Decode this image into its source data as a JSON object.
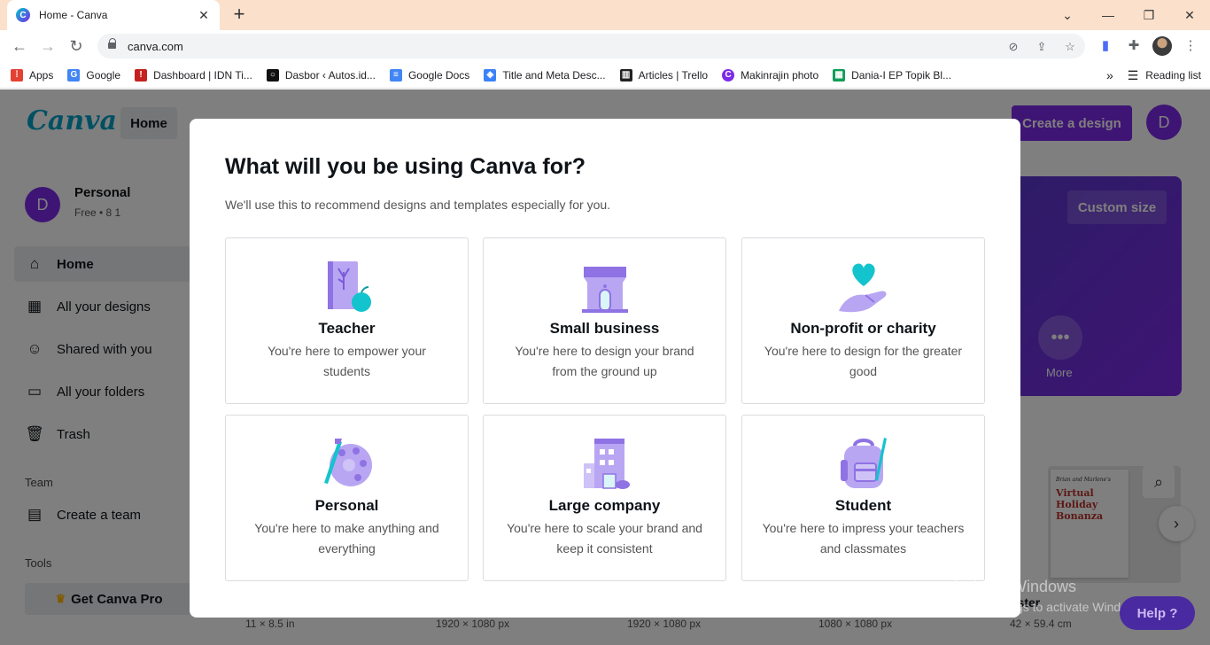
{
  "browser": {
    "tab_title": "Home - Canva",
    "url": "canva.com",
    "bookmarks": [
      {
        "label": "Apps",
        "color": "#e34133"
      },
      {
        "label": "Google",
        "color": "#4285f4"
      },
      {
        "label": "Dashboard | IDN Ti...",
        "color": "#c5221f"
      },
      {
        "label": "Dasbor ‹ Autos.id...",
        "color": "#111111"
      },
      {
        "label": "Google Docs",
        "color": "#4285f4"
      },
      {
        "label": "Title and Meta Desc...",
        "color": "#3b82f6"
      },
      {
        "label": "Articles | Trello",
        "color": "#222222"
      },
      {
        "label": "Makinrajin photo",
        "color": "#7d2ae8"
      },
      {
        "label": "Dania-I EP Topik Bl...",
        "color": "#0f9d58"
      }
    ],
    "reading_list": "Reading list"
  },
  "canva": {
    "logo": "Canva",
    "home_pill": "Home",
    "create_button": "Create a design",
    "avatar_initial": "D",
    "account": {
      "name": "Personal",
      "plan": "Free • 8 1"
    },
    "sidebar": [
      {
        "label": "Home",
        "icon": "⌂"
      },
      {
        "label": "All your designs",
        "icon": "▦"
      },
      {
        "label": "Shared with you",
        "icon": "☺"
      },
      {
        "label": "All your folders",
        "icon": "▭"
      },
      {
        "label": "Trash",
        "icon": "🗑"
      }
    ],
    "team_heading": "Team",
    "create_team": "Create a team",
    "tools_heading": "Tools",
    "get_pro": "Get Canva Pro",
    "custom_size": "Custom size",
    "more_label": "More",
    "poster": {
      "small_text": "Brian and Marlene's",
      "title": "Virtual Holiday Bonanza",
      "label": "oster"
    },
    "dimensions": [
      "11 × 8.5 in",
      "1920 × 1080 px",
      "1920 × 1080 px",
      "1080 × 1080 px",
      "42 × 59.4 cm"
    ]
  },
  "modal": {
    "title": "What will you be using Canva for?",
    "subtitle": "We'll use this to recommend designs and templates especially for you.",
    "options": [
      {
        "title": "Teacher",
        "desc": "You're here to empower your students",
        "icon": "book-apple-icon"
      },
      {
        "title": "Small business",
        "desc": "You're here to design your brand from the ground up",
        "icon": "storefront-icon"
      },
      {
        "title": "Non-profit or charity",
        "desc": "You're here to design for the greater good",
        "icon": "heart-hand-icon"
      },
      {
        "title": "Personal",
        "desc": "You're here to make anything and everything",
        "icon": "palette-icon"
      },
      {
        "title": "Large company",
        "desc": "You're here to scale your brand and keep it consistent",
        "icon": "office-building-icon"
      },
      {
        "title": "Student",
        "desc": "You're here to impress your teachers and classmates",
        "icon": "backpack-icon"
      }
    ]
  },
  "watermark": {
    "line1": "Activate Windows",
    "line2": "Go to Settings to activate Windows."
  },
  "help": "Help ?",
  "colors": {
    "accent": "#7d2ae8",
    "icon_lavender": "#b9a6f2",
    "icon_purple": "#8f72e4",
    "icon_teal": "#13c3cd"
  }
}
